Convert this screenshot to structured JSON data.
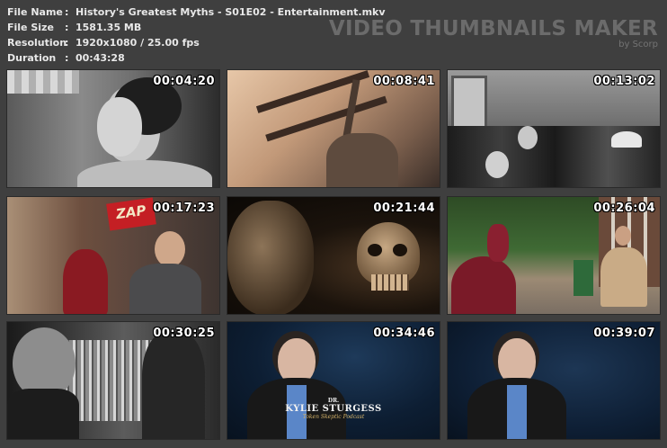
{
  "info": [
    {
      "key": "File Name",
      "value": "History's Greatest Myths - S01E02 - Entertainment.mkv"
    },
    {
      "key": "File Size",
      "value": "1581.35 MB"
    },
    {
      "key": "Resolution",
      "value": "1920x1080 / 25.00 fps"
    },
    {
      "key": "Duration",
      "value": "00:43:28"
    }
  ],
  "separator": ":",
  "brand": {
    "title": "VIDEO THUMBNAILS MAKER",
    "subtitle": "by Scorp"
  },
  "thumbnails": [
    {
      "timestamp": "00:04:20"
    },
    {
      "timestamp": "00:08:41"
    },
    {
      "timestamp": "00:13:02"
    },
    {
      "timestamp": "00:17:23",
      "sign": "ZAP"
    },
    {
      "timestamp": "00:21:44"
    },
    {
      "timestamp": "00:26:04"
    },
    {
      "timestamp": "00:30:25"
    },
    {
      "timestamp": "00:34:46",
      "caption_prefix": "DR.",
      "caption_name": "KYLIE STURGESS",
      "caption_sub": "Token Skeptic Podcast"
    },
    {
      "timestamp": "00:39:07"
    }
  ],
  "colors": {
    "background": "#3f3f3f",
    "text": "#e8e8e8",
    "brand": "#6b6b6b"
  }
}
